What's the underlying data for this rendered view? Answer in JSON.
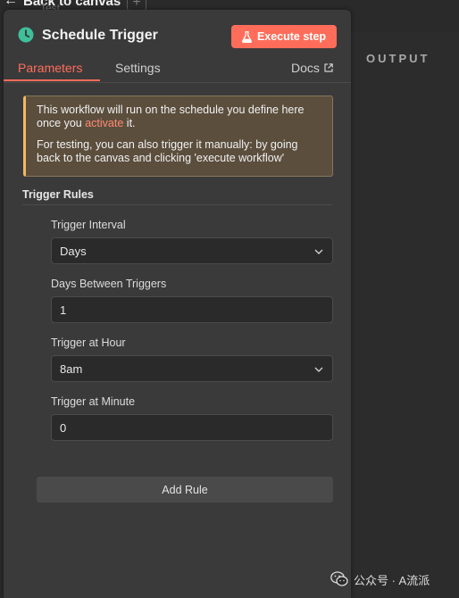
{
  "topbar": {
    "back_label": "Back to canvas",
    "ghost_text": "Test"
  },
  "output": {
    "label": "OUTPUT"
  },
  "panel": {
    "title": "Schedule Trigger",
    "execute_label": "Execute step",
    "tabs": [
      {
        "label": "Parameters",
        "active": true
      },
      {
        "label": "Settings",
        "active": false
      }
    ],
    "docs_label": "Docs"
  },
  "notice": {
    "line1_before": "This workflow will run on the schedule you define here once you ",
    "line1_link": "activate",
    "line1_after": " it.",
    "line2": "For testing, you can also trigger it manually: by going back to the canvas and clicking 'execute workflow'"
  },
  "rules": {
    "section_title": "Trigger Rules",
    "fields": [
      {
        "label": "Trigger Interval",
        "value": "Days",
        "kind": "select"
      },
      {
        "label": "Days Between Triggers",
        "value": "1",
        "kind": "input"
      },
      {
        "label": "Trigger at Hour",
        "value": "8am",
        "kind": "select"
      },
      {
        "label": "Trigger at Minute",
        "value": "0",
        "kind": "input"
      }
    ],
    "add_rule_label": "Add Rule"
  },
  "watermark": {
    "text": "公众号 · A流派"
  },
  "colors": {
    "accent": "#ff6d5a",
    "clock_icon": "#3fbf9a",
    "notice_bg": "#5b4e3d",
    "notice_border": "#f0b964"
  }
}
